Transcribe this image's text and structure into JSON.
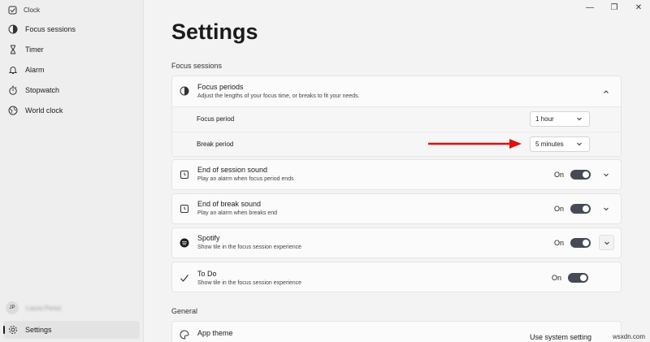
{
  "app": {
    "title": "Clock"
  },
  "sidebar": {
    "items": [
      {
        "label": "Focus sessions",
        "icon": "focus-icon"
      },
      {
        "label": "Timer",
        "icon": "hourglass-icon"
      },
      {
        "label": "Alarm",
        "icon": "bell-icon"
      },
      {
        "label": "Stopwatch",
        "icon": "stopwatch-icon"
      },
      {
        "label": "World clock",
        "icon": "globe-icon"
      }
    ],
    "profile": {
      "initials": "JP",
      "name": "Laura Perez"
    },
    "settings_label": "Settings"
  },
  "main": {
    "title": "Settings",
    "focus_section_label": "Focus sessions",
    "general_section_label": "General",
    "focus_periods": {
      "title": "Focus periods",
      "subtitle": "Adjust the lengths of your focus time, or breaks to fit your needs.",
      "focus_period_label": "Focus period",
      "focus_period_value": "1 hour",
      "break_period_label": "Break period",
      "break_period_value": "5 minutes"
    },
    "end_session_sound": {
      "title": "End of session sound",
      "subtitle": "Play an alarm when focus period ends",
      "state": "On"
    },
    "end_break_sound": {
      "title": "End of break sound",
      "subtitle": "Play an alarm when breaks end",
      "state": "On"
    },
    "spotify": {
      "title": "Spotify",
      "subtitle": "Show tile in the focus session experience",
      "state": "On"
    },
    "todo": {
      "title": "To Do",
      "subtitle": "Show tile in the focus session experience",
      "state": "On"
    },
    "app_theme": {
      "title": "App theme",
      "value": "Use system setting"
    }
  },
  "watermark": "wsxdn.com",
  "colors": {
    "toggle_on": "#464a55",
    "annotation_arrow": "#e01010",
    "page_bg": "#f3f3f3",
    "card_bg": "#fbfbfb"
  }
}
